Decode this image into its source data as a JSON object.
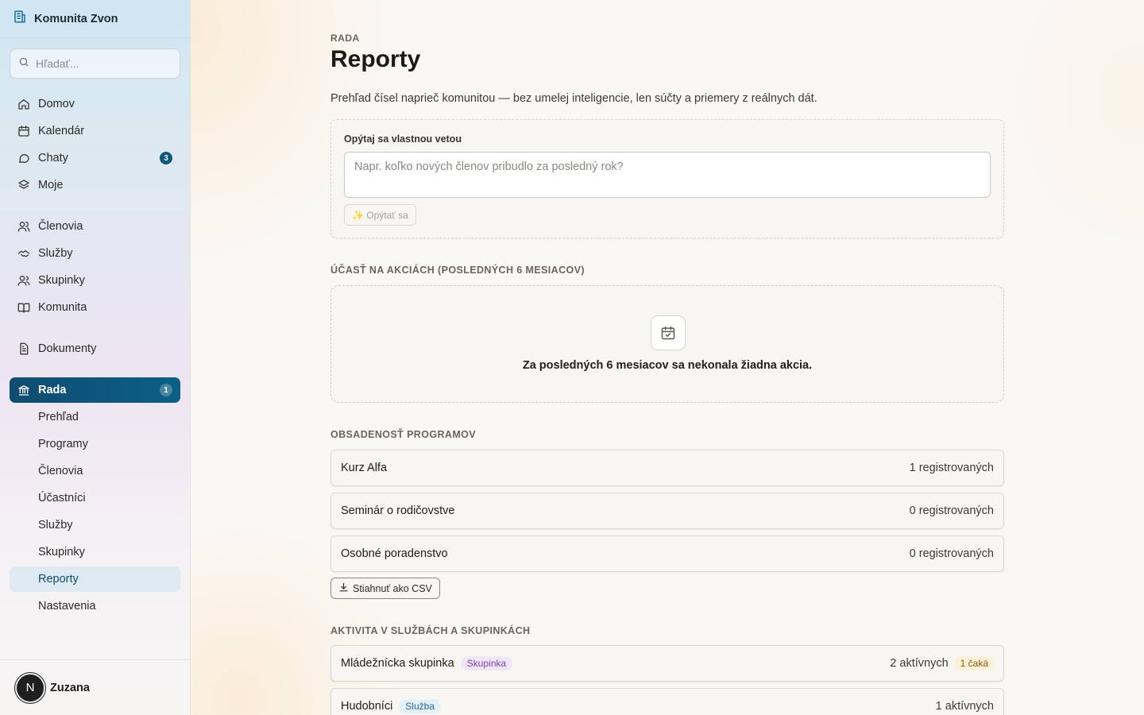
{
  "sidebar": {
    "brand": {
      "name": "Komunita Zvon",
      "icon": "building-icon"
    },
    "search": {
      "placeholder": "Hľadať..."
    },
    "nav": [
      {
        "label": "Domov",
        "icon": "home-icon"
      },
      {
        "label": "Kalendár",
        "icon": "calendar-icon"
      },
      {
        "label": "Chaty",
        "icon": "chat-icon",
        "badge": "3"
      },
      {
        "label": "Moje",
        "icon": "layers-icon"
      },
      {
        "label": "Členovia",
        "icon": "users-icon"
      },
      {
        "label": "Služby",
        "icon": "handshake-icon"
      },
      {
        "label": "Skupinky",
        "icon": "group-icon"
      },
      {
        "label": "Komunita",
        "icon": "book-icon"
      },
      {
        "label": "Dokumenty",
        "icon": "document-icon"
      },
      {
        "label": "Rada",
        "icon": "bank-icon",
        "badge": "1",
        "active": true
      }
    ],
    "subnav": [
      {
        "label": "Prehľad"
      },
      {
        "label": "Programy"
      },
      {
        "label": "Členovia"
      },
      {
        "label": "Účastníci"
      },
      {
        "label": "Služby"
      },
      {
        "label": "Skupinky"
      },
      {
        "label": "Reporty",
        "current": true
      },
      {
        "label": "Nastavenia"
      }
    ],
    "user": {
      "initial": "N",
      "name": "Zuzana"
    }
  },
  "main": {
    "eyebrow": "RADA",
    "title": "Reporty",
    "description": "Prehľad čísel naprieč komunitou — bez umelej inteligencie, len súčty a priemery z reálnych dát.",
    "ask": {
      "label": "Opýtaj sa vlastnou vetou",
      "placeholder": "Napr. koľko nových členov pribudlo za posledný rok?",
      "button": "✨ Opýtať sa"
    },
    "attendance": {
      "heading": "ÚČASŤ NA AKCIÁCH (POSLEDNÝCH 6 MESIACOV)",
      "empty_text": "Za posledných 6 mesiacov sa nekonala žiadna akcia."
    },
    "programs": {
      "heading": "OBSADENOSŤ PROGRAMOV",
      "rows": [
        {
          "name": "Kurz Alfa",
          "value": "1 registrovaných"
        },
        {
          "name": "Seminár o rodičovstve",
          "value": "0 registrovaných"
        },
        {
          "name": "Osobné poradenstvo",
          "value": "0 registrovaných"
        }
      ],
      "csv_button": "Stiahnuť ako CSV"
    },
    "activity": {
      "heading": "AKTIVITA V SLUŽBÁCH A SKUPINKÁCH",
      "rows": [
        {
          "name": "Mládežnícka skupinka",
          "tag": "Skupinka",
          "value": "2 aktívnych",
          "waiting": "1 čaká"
        },
        {
          "name": "Hudobníci",
          "tag": "Služba",
          "value": "1 aktívnych"
        }
      ]
    }
  },
  "colors": {
    "accent": "#0c5f87",
    "badge": "#0b5a7e"
  }
}
